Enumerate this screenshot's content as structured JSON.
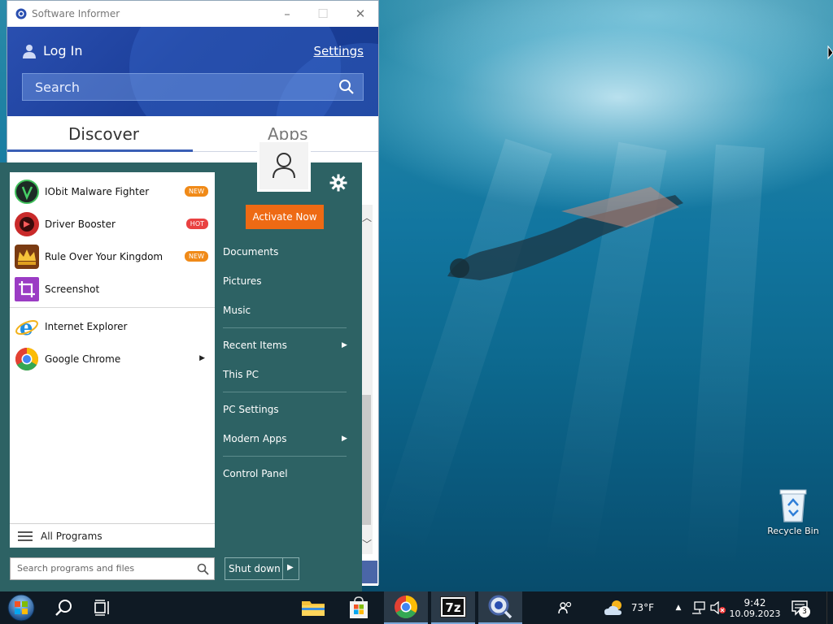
{
  "window": {
    "title": "Software Informer",
    "login_label": "Log In",
    "settings_label": "Settings",
    "search_placeholder": "Search",
    "tabs": [
      {
        "label": "Discover",
        "active": true
      },
      {
        "label": "Apps",
        "active": false
      }
    ]
  },
  "start_menu": {
    "pinned": [
      {
        "label": "IObit Malware Fighter",
        "badge": "NEW",
        "icon": "iobit-malware-fighter-icon"
      },
      {
        "label": "Driver Booster",
        "badge": "HOT",
        "icon": "driver-booster-icon"
      },
      {
        "label": "Rule Over Your Kingdom",
        "badge": "NEW",
        "icon": "crown-icon"
      },
      {
        "label": "Screenshot",
        "badge": "",
        "icon": "screenshot-crop-icon"
      }
    ],
    "recent": [
      {
        "label": "Internet Explorer",
        "icon": "internet-explorer-icon"
      },
      {
        "label": "Google Chrome",
        "icon": "chrome-icon",
        "has_submenu": true
      }
    ],
    "all_programs_label": "All Programs",
    "search_placeholder": "Search programs and files",
    "activate_label": "Activate Now",
    "right_items": [
      {
        "label": "Documents"
      },
      {
        "label": "Pictures"
      },
      {
        "label": "Music"
      },
      {
        "label": "Recent Items",
        "has_submenu": true
      },
      {
        "label": "This PC"
      },
      {
        "label": "PC Settings"
      },
      {
        "label": "Modern Apps",
        "has_submenu": true
      },
      {
        "label": "Control Panel"
      }
    ],
    "shutdown_label": "Shut down"
  },
  "desktop": {
    "recycle_bin_label": "Recycle Bin"
  },
  "taskbar": {
    "weather_temp": "73°F",
    "time": "9:42",
    "date": "10.09.2023",
    "notification_count": "3",
    "pinned_apps": [
      "file-explorer-icon",
      "microsoft-store-icon",
      "chrome-icon",
      "7zip-icon",
      "magnifier-app-icon"
    ]
  },
  "colors": {
    "header_blue": "#1c3f9a",
    "start_teal": "#2d6264",
    "activate_orange": "#ee6a14",
    "badge_new": "#f08a18",
    "badge_hot": "#e94141"
  }
}
